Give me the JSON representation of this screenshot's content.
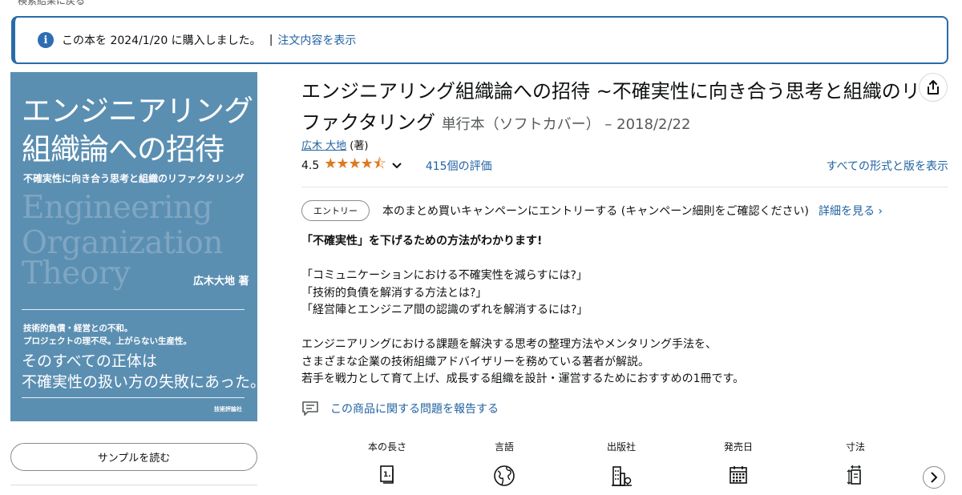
{
  "back_link": "検索結果に戻る",
  "purchase_notice": {
    "message": "この本を 2024/1/20 に購入しました。",
    "separator": "|",
    "link": "注文内容を表示"
  },
  "cover": {
    "title_line1": "エンジニアリング",
    "title_line2": "組織論への招待",
    "subtitle": "不確実性に向き合う思考と組織のリファクタリング",
    "english_line1": "Engineering",
    "english_line2": "Organization",
    "english_line3": "Theory",
    "author": "広木大地 著",
    "tagline1": "技術的負債・経営との不和。",
    "tagline2": "プロジェクトの理不尽。上がらない生産性。",
    "big_line1": "そのすべての正体は",
    "big_line2": "不確実性の扱い方の失敗にあった。",
    "publisher": "技術評論社"
  },
  "sample_button": "サンプルを読む",
  "product": {
    "title": "エンジニアリング組織論への招待 ~不確実性に向き合う思考と組織のリファクタリング",
    "binding": "単行本（ソフトカバー） – 2018/2/22",
    "author_name": "広木 大地",
    "author_role": "(著)",
    "rating": "4.5",
    "stars": "★★★★⯪",
    "rating_count": "415個の評価",
    "all_formats": "すべての形式と版を表示"
  },
  "campaign": {
    "entry_button": "エントリー",
    "text": "本のまとめ買いキャンペーンにエントリーする (キャンペーン細則をご確認ください)",
    "details_link": "詳細を見る ›"
  },
  "description": {
    "headline": "「不確実性」を下げるための方法がわかります!",
    "q1": "「コミュニケーションにおける不確実性を減らすには?」",
    "q2": "「技術的負債を解消する方法とは?」",
    "q3": "「経営陣とエンジニア間の認識のずれを解消するには?」",
    "p1": "エンジニアリングにおける課題を解決する思考の整理方法やメンタリング手法を、",
    "p2": "さまざまな企業の技術組織アドバイザリーを務めている著者が解説。",
    "p3": "若手を戦力として育て上げ、成長する組織を設計・運営するためにおすすめの1冊です。"
  },
  "report_link": "この商品に関する問題を報告する",
  "attributes": [
    {
      "label": "本の長さ",
      "icon": "book-length-icon"
    },
    {
      "label": "言語",
      "icon": "globe-icon"
    },
    {
      "label": "出版社",
      "icon": "building-icon"
    },
    {
      "label": "発売日",
      "icon": "calendar-icon"
    },
    {
      "label": "寸法",
      "icon": "dimensions-icon"
    }
  ],
  "colors": {
    "link": "#2162a1",
    "star": "#de7921",
    "alert_border": "#2a6aa8",
    "cover_bg": "#5b8fb2"
  }
}
